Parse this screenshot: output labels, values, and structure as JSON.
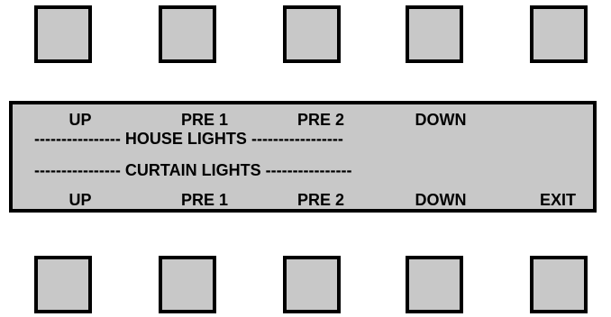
{
  "panel": {
    "top_row": [
      "UP",
      "PRE 1",
      "PRE 2",
      "DOWN"
    ],
    "house_divider": {
      "left_dashes": "----------------",
      "title": "HOUSE LIGHTS",
      "right_dashes": "-----------------"
    },
    "curtain_divider": {
      "left_dashes": "----------------",
      "title": "CURTAIN LIGHTS",
      "right_dashes": "----------------"
    },
    "bottom_row": [
      "UP",
      "PRE 1",
      "PRE 2",
      "DOWN",
      "EXIT"
    ]
  },
  "colors": {
    "key_fill": "#c8c8c8",
    "display_fill": "#c8c8c8",
    "border": "#000000",
    "background": "#ffffff"
  }
}
